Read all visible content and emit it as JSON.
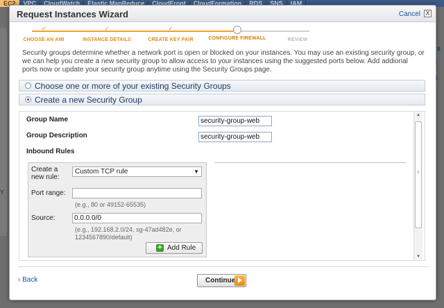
{
  "bg_nav": {
    "tabs": [
      "EC2",
      "VPC",
      "CloudWatch",
      "Elastic MapReduce",
      "CloudFront",
      "CloudFormation",
      "RDS",
      "SNS",
      "IAM"
    ],
    "active_tab": "EC2"
  },
  "dialog": {
    "title": "Request Instances Wizard",
    "cancel_label": "Cancel",
    "close_glyph": "X"
  },
  "steps": [
    {
      "label": "CHOOSE AN AMI",
      "status": "done"
    },
    {
      "label": "INSTANCE DETAILS",
      "status": "done"
    },
    {
      "label": "CREATE KEY PAIR",
      "status": "done"
    },
    {
      "label": "CONFIGURE FIREWALL",
      "status": "current"
    },
    {
      "label": "REVIEW",
      "status": "future"
    }
  ],
  "step_done_mark": "✓",
  "intro_text": "Security groups determine whether a network port is open or blocked on your instances. You may use an existing security group, or we can help you create a new security group to allow access to your instances using the suggested ports below. Add addional ports now or update your security group anytime using the Security Groups page.",
  "sections": {
    "existing_label": "Choose one or more of your existing Security Groups",
    "create_label": "Create a new Security Group"
  },
  "form": {
    "group_name_label": "Group Name",
    "group_name_value": "security-group-web",
    "group_desc_label": "Group Description",
    "group_desc_value": "security-group-web",
    "inbound_rules_label": "Inbound Rules"
  },
  "rule": {
    "create_label_1": "Create a",
    "create_label_2": "new rule:",
    "rule_type_value": "Custom TCP rule",
    "port_range_label": "Port range:",
    "port_range_value": "",
    "port_hint": "(e.g., 80 or 49152-65535)",
    "source_label": "Source:",
    "source_value": "0.0.0.0/0",
    "source_hint_1": "(e.g., 192.168.2.0/24, sg-47ad482e, or",
    "source_hint_2": "1234567890/default)",
    "add_rule_label": "Add Rule"
  },
  "footer": {
    "back_label": "‹ Back",
    "continue_label": "Continue"
  },
  "colors": {
    "accent_orange": "#e08a12",
    "link_blue": "#1a4f9c",
    "section_text": "#1f3b62"
  }
}
